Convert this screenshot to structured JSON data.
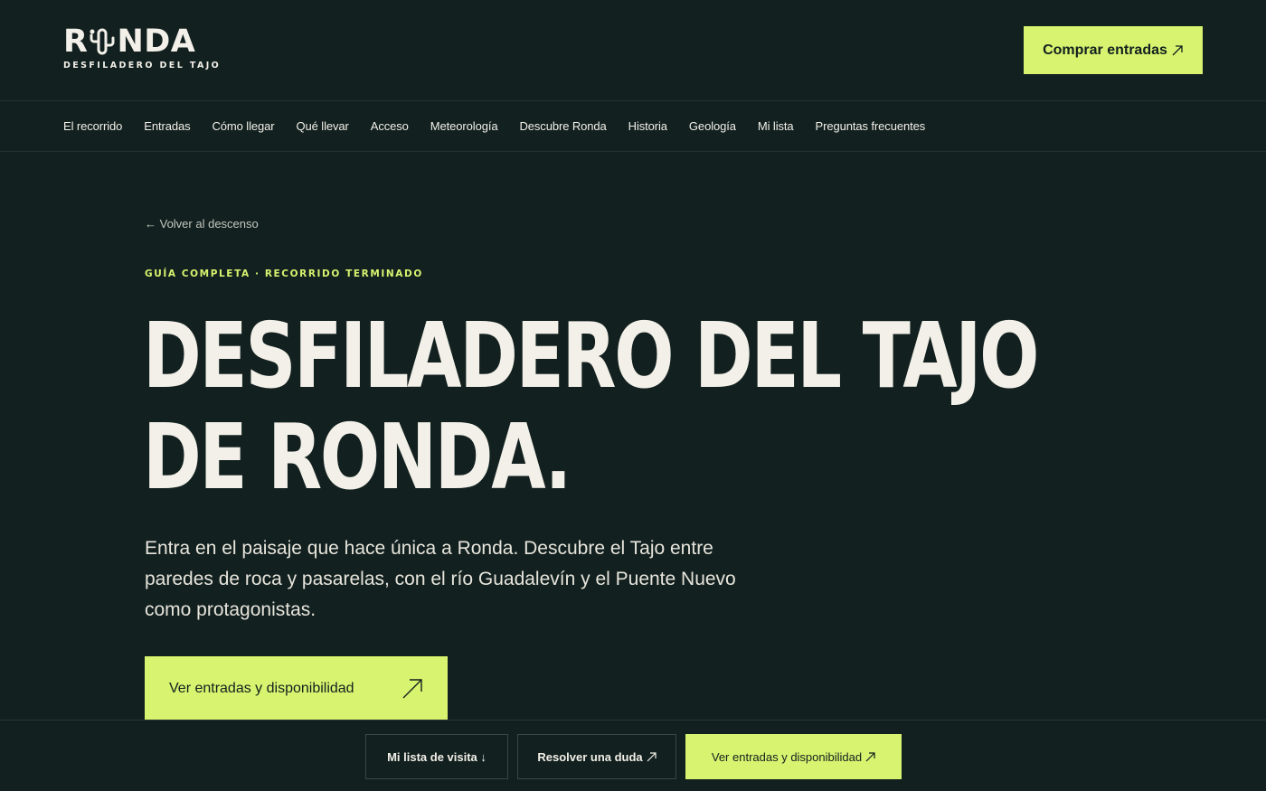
{
  "header": {
    "logo_word_left": "R",
    "logo_word_right": "NDA",
    "logo_subtitle": "DESFILADERO DEL TAJO",
    "buy_label": "Comprar entradas"
  },
  "nav": {
    "items": [
      {
        "label": "El recorrido"
      },
      {
        "label": "Entradas"
      },
      {
        "label": "Cómo llegar"
      },
      {
        "label": "Qué llevar"
      },
      {
        "label": "Acceso"
      },
      {
        "label": "Meteorología"
      },
      {
        "label": "Descubre Ronda"
      },
      {
        "label": "Historia"
      },
      {
        "label": "Geología"
      },
      {
        "label": "Mi lista"
      },
      {
        "label": "Preguntas frecuentes"
      }
    ]
  },
  "hero": {
    "back_label": "← Volver al descenso",
    "eyebrow": "GUÍA COMPLETA · RECORRIDO TERMINADO",
    "title_line1": "DESFILADERO DEL TAJO",
    "title_line2": "DE RONDA.",
    "description": "Entra en el paisaje que hace única a Ronda. Descubre el Tajo entre paredes de roca y pasarelas, con el río Guadalevín y el Puente Nuevo como protagonistas.",
    "cta_label": "Ver entradas y disponibilidad"
  },
  "bottom_bar": {
    "list_label": "Mi lista de visita ↓",
    "ask_label": "Resolver una duda",
    "primary_label": "Ver entradas y disponibilidad"
  },
  "colors": {
    "background": "#12201f",
    "accent": "#d8f36f",
    "text": "#f2f0e8"
  }
}
